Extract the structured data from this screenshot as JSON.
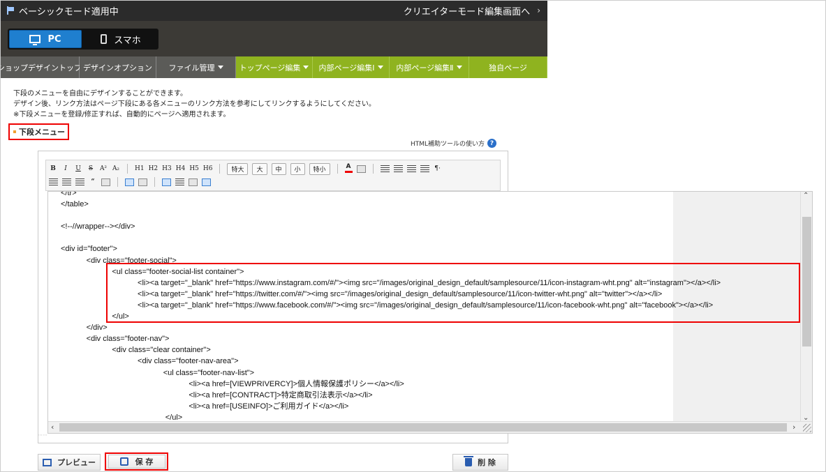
{
  "header": {
    "mode_label": "ベーシックモード適用中",
    "creator_link": "クリエイターモード編集画面へ",
    "creator_arrow": "›"
  },
  "devices": {
    "pc_label": "PC",
    "sp_label": "スマホ",
    "active": "pc"
  },
  "nav": {
    "tabs": [
      {
        "label": "ショップデザイントップ",
        "style": "dark",
        "caret": false
      },
      {
        "label": "デザインオプション",
        "style": "dark",
        "caret": false
      },
      {
        "label": "ファイル管理",
        "style": "dark",
        "caret": true
      },
      {
        "label": "トップページ編集",
        "style": "green",
        "caret": true
      },
      {
        "label": "内部ページ編集Ⅰ",
        "style": "green",
        "caret": true
      },
      {
        "label": "内部ページ編集Ⅱ",
        "style": "green",
        "caret": true
      },
      {
        "label": "独自ページ",
        "style": "green",
        "caret": false
      }
    ]
  },
  "description": {
    "line1": "下段のメニューを自由にデザインすることができます。",
    "line2": "デザイン後、リンク方法はページ下段にある各メニューのリンク方法を参考にしてリンクするようにしてください。",
    "line3": "※下段メニューを登録/修正すれば、自動的にページへ適用されます。"
  },
  "section": {
    "title": "下段メニュー"
  },
  "help": {
    "label": "HTML補助ツールの使い方",
    "icon": "?"
  },
  "toolbar": {
    "row1": [
      "B",
      "I",
      "U",
      "S",
      "A²",
      "A₂",
      "H1",
      "H2",
      "H3",
      "H4",
      "H5",
      "H6"
    ],
    "sizes": [
      "特大",
      "大",
      "中",
      "小",
      "特小"
    ],
    "para_symbol": "¶·",
    "quote_symbol": "“"
  },
  "code": {
    "lines": [
      "</tr>",
      "</table>",
      "",
      "<!--//wrapper--></div>",
      "",
      "<div id=\"footer\">",
      "            <div class=\"footer-social\">",
      "                        <ul class=\"footer-social-list container\">",
      "                                    <li><a target=\"_blank\" href=\"https://www.instagram.com/#/\"><img src=\"/images/original_design_default/samplesource/11/icon-instagram-wht.png\" alt=\"instagram\"></a></li>",
      "                                    <li><a target=\"_blank\" href=\"https://twitter.com/#/\"><img src=\"/images/original_design_default/samplesource/11/icon-twitter-wht.png\" alt=\"twitter\"></a></li>",
      "                                    <li><a target=\"_blank\" href=\"https://www.facebook.com/#/\"><img src=\"/images/original_design_default/samplesource/11/icon-facebook-wht.png\" alt=\"facebook\"></a></li>",
      "                        </ul>",
      "            </div>",
      "            <div class=\"footer-nav\">",
      "                        <div class=\"clear container\">",
      "                                    <div class=\"footer-nav-area\">",
      "                                                <ul class=\"footer-nav-list\">",
      "                                                            <li><a href=[VIEWPRIVERCY]>個人情報保護ポリシー</a></li>",
      "                                                            <li><a href=[CONTRACT]>特定商取引法表示</a></li>",
      "                                                            <li><a href=[USEINFO]>ご利用ガイド</a></li>",
      "                                                 </ul>"
    ]
  },
  "buttons": {
    "preview": "プレビュー",
    "save": "保 存",
    "delete": "削 除"
  },
  "colors": {
    "header_bg": "#2b2b2b",
    "accent_blue": "#1f7fcf",
    "nav_green": "#8fb31f",
    "highlight_red": "#e00000"
  }
}
